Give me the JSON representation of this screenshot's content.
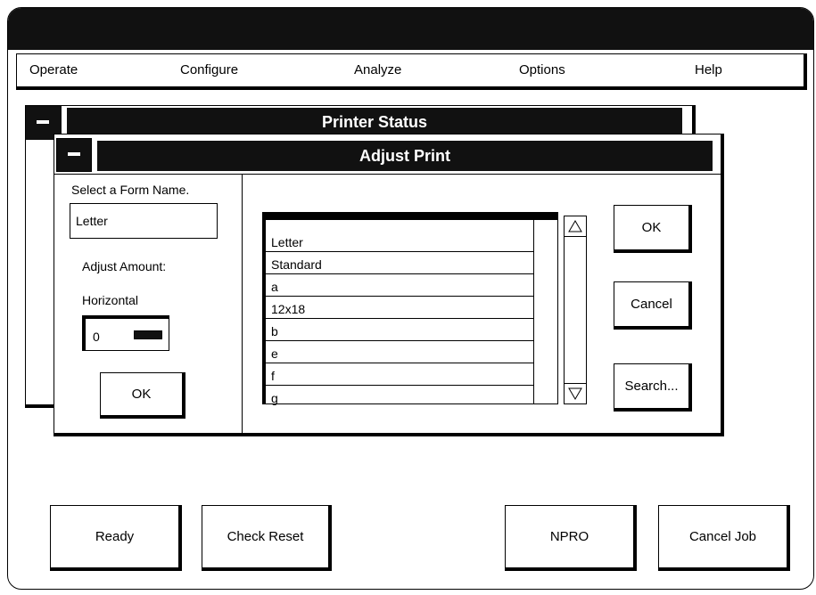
{
  "menu": {
    "items": [
      "Operate",
      "Configure",
      "Analyze",
      "Options",
      "Help"
    ]
  },
  "printer_status": {
    "title": "Printer Status"
  },
  "adjust_print": {
    "title": "Adjust Print",
    "select_label": "Select a Form Name.",
    "form_name_value": "Letter",
    "adjust_amount_label": "Adjust Amount:",
    "horizontal_label": "Horizontal",
    "horizontal_value": "0",
    "ok_left_label": "OK",
    "forms": [
      "Letter",
      "Standard",
      "a",
      "12x18",
      "b",
      "e",
      "f",
      "g"
    ],
    "ok_label": "OK",
    "cancel_label": "Cancel",
    "search_label": "Search..."
  },
  "bottom_buttons": {
    "ready": "Ready",
    "check_reset": "Check Reset",
    "npro": "NPRO",
    "cancel_job": "Cancel Job"
  },
  "icons": {
    "system_menu": "minus-icon",
    "scroll_up": "triangle-up-icon",
    "scroll_down": "triangle-down-icon"
  }
}
